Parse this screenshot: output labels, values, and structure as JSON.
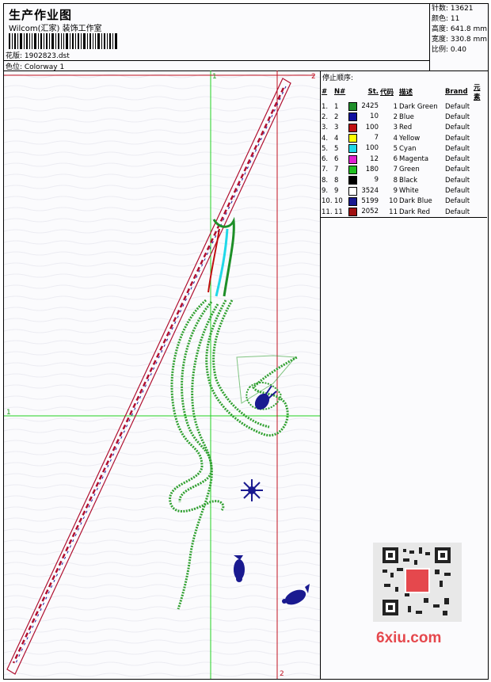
{
  "header": {
    "title": "生产作业图",
    "company": "Wilcom(汇家) 装饰工作室",
    "design_label": "花版: 1902823.dst",
    "colorway_label": "色位: Colorway 1"
  },
  "stats": {
    "stitches": "针数: 13621",
    "colors": "颜色: 11",
    "height": "高度: 641.8 mm",
    "width": "宽度: 330.8 mm",
    "scale": "比例: 0.40"
  },
  "panel": {
    "title": "停止顺序:",
    "headers": [
      "#",
      "N#",
      "St.",
      "代码",
      "描述",
      "Brand",
      "元素"
    ]
  },
  "color_stops": [
    {
      "idx": "1.",
      "n": "1",
      "st": "2425",
      "code": "1",
      "desc": "Dark Green",
      "brand": "Default",
      "color": "#1f8f2a"
    },
    {
      "idx": "2.",
      "n": "2",
      "st": "10",
      "code": "2",
      "desc": "Blue",
      "brand": "Default",
      "color": "#1010a0"
    },
    {
      "idx": "3.",
      "n": "3",
      "st": "100",
      "code": "3",
      "desc": "Red",
      "brand": "Default",
      "color": "#c01010"
    },
    {
      "idx": "4.",
      "n": "4",
      "st": "7",
      "code": "4",
      "desc": "Yellow",
      "brand": "Default",
      "color": "#ffff00"
    },
    {
      "idx": "5.",
      "n": "5",
      "st": "100",
      "code": "5",
      "desc": "Cyan",
      "brand": "Default",
      "color": "#20d8e8"
    },
    {
      "idx": "6.",
      "n": "6",
      "st": "12",
      "code": "6",
      "desc": "Magenta",
      "brand": "Default",
      "color": "#e020d0"
    },
    {
      "idx": "7.",
      "n": "7",
      "st": "180",
      "code": "7",
      "desc": "Green",
      "brand": "Default",
      "color": "#20c020"
    },
    {
      "idx": "8.",
      "n": "8",
      "st": "9",
      "code": "8",
      "desc": "Black",
      "brand": "Default",
      "color": "#000000"
    },
    {
      "idx": "9.",
      "n": "9",
      "st": "3524",
      "code": "9",
      "desc": "White",
      "brand": "Default",
      "color": "#ffffff"
    },
    {
      "idx": "10.",
      "n": "10",
      "st": "5199",
      "code": "10",
      "desc": "Dark Blue",
      "brand": "Default",
      "color": "#1a1a90"
    },
    {
      "idx": "11.",
      "n": "11",
      "st": "2052",
      "code": "11",
      "desc": "Dark Red",
      "brand": "Default",
      "color": "#a01010"
    }
  ],
  "design": {
    "guide_labels": {
      "v1": "1",
      "h1": "1",
      "v2_top": "2",
      "v2_bottom": "2"
    },
    "guide_colors": {
      "green": "#20d020",
      "red": "#c01020"
    },
    "element_icons": [
      "diagonal-stripe-graphic",
      "seahorse-stem-graphic",
      "blue-motif-graphic",
      "flower-icon",
      "fish-icon"
    ]
  },
  "watermark": {
    "text": "6xiu.com",
    "icon": "qr-code-icon"
  }
}
